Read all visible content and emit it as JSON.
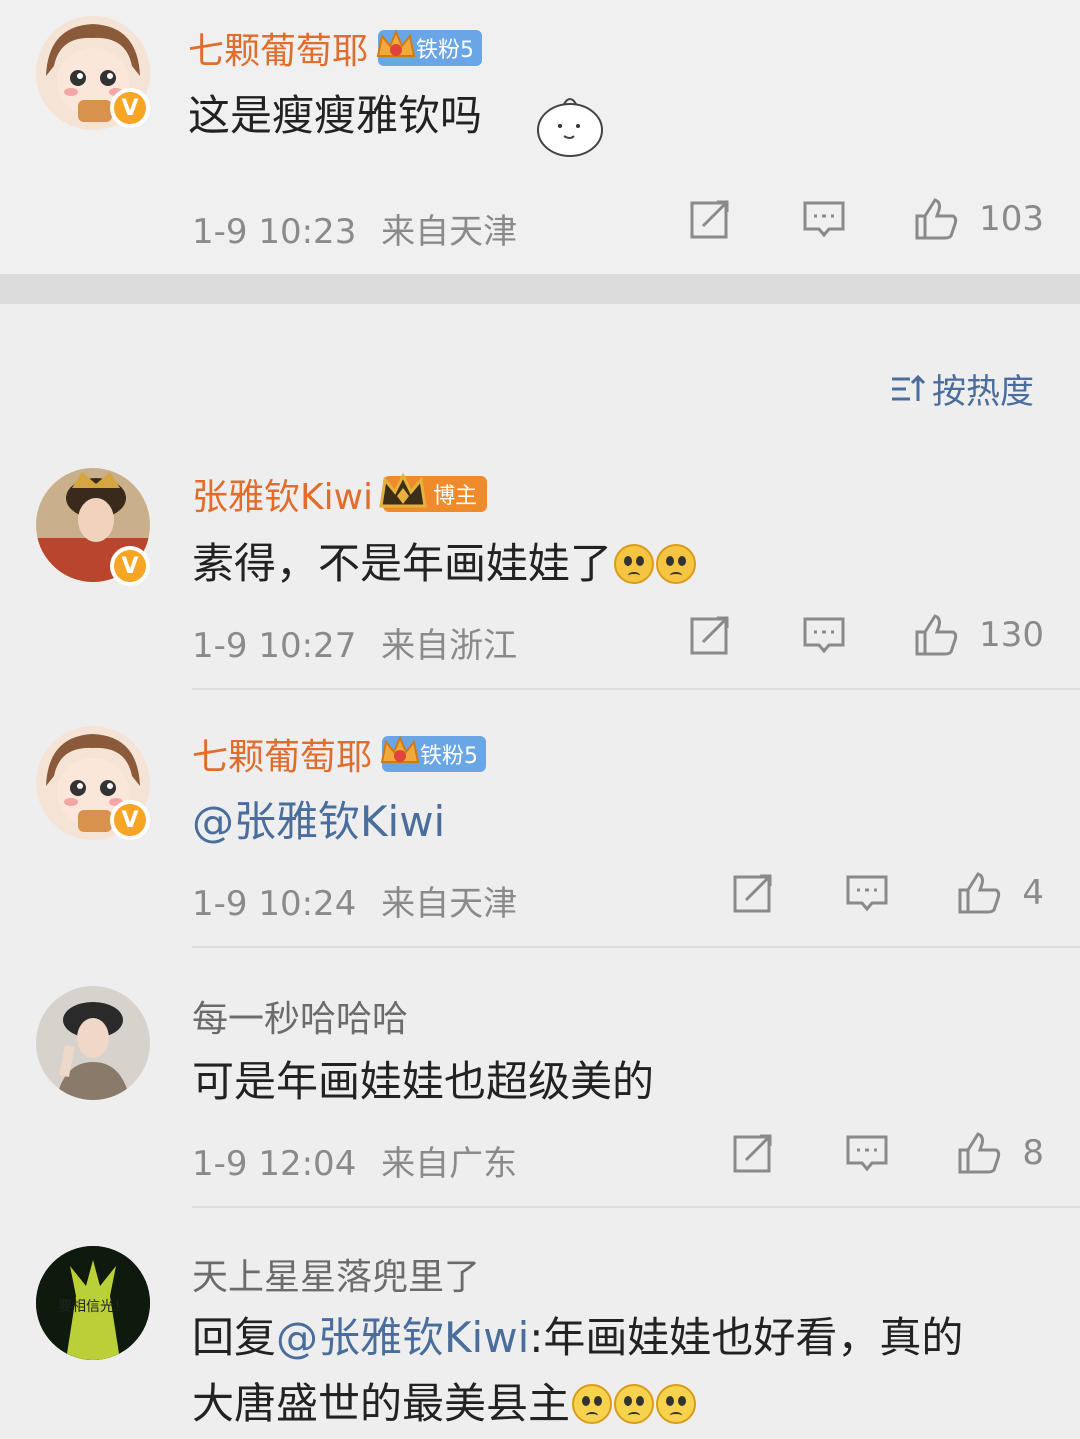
{
  "comments": [
    {
      "user": "七颗葡萄耶",
      "badge": "铁粉5",
      "text": "这是瘦瘦雅钦吗",
      "time": "1-9 10:23",
      "location": "来自天津",
      "likes": "103"
    },
    {
      "user": "张雅钦Kiwi",
      "badge": "博主",
      "text": "素得，不是年画娃娃了",
      "time": "1-9 10:27",
      "location": "来自浙江",
      "likes": "130"
    },
    {
      "user": "七颗葡萄耶",
      "badge": "铁粉5",
      "text": "@张雅钦Kiwi",
      "time": "1-9 10:24",
      "location": "来自天津",
      "likes": "4"
    },
    {
      "user": "每一秒哈哈哈",
      "text": "可是年画娃娃也超级美的",
      "time": "1-9 12:04",
      "location": "来自广东",
      "likes": "8"
    },
    {
      "user": "天上星星落兜里了",
      "avatar_text": "要相信光！",
      "reply_prefix": "回复",
      "mention": "@张雅钦Kiwi",
      "text_line1": ":年画娃娃也好看，真的",
      "text_line2": "大唐盛世的最美县主"
    }
  ],
  "sort": {
    "label": "按热度"
  },
  "colors": {
    "accent_orange": "#e06d2b",
    "link_blue": "#4a6d9c",
    "meta_gray": "#8a8a8a"
  }
}
